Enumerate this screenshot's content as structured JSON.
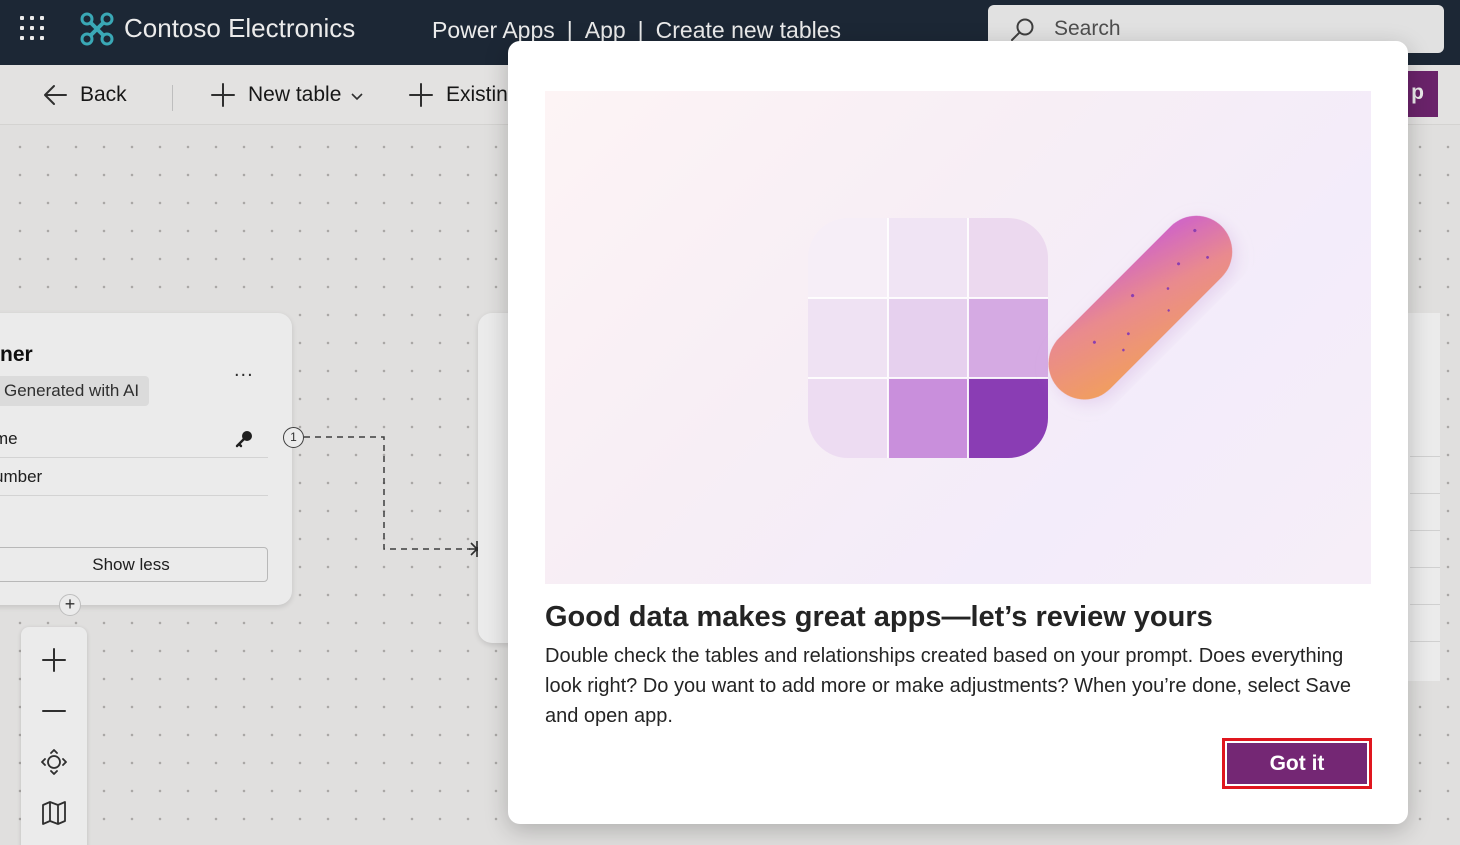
{
  "header": {
    "brand": "Contoso Electronics",
    "breadcrumbs": [
      "Power Apps",
      "App",
      "Create new tables"
    ],
    "breadcrumb_separator": "|",
    "search_placeholder": "Search"
  },
  "toolbar": {
    "back_label": "Back",
    "new_table_label": "New table",
    "existing_label": "Existin",
    "primary_partial": "p"
  },
  "table_card": {
    "title": "ner",
    "badge": "Generated with AI",
    "more": "...",
    "fields": [
      "me",
      "umber"
    ],
    "show_less": "Show less",
    "relationship_count": "1"
  },
  "dialog": {
    "title": "Good data makes great apps—let’s review yours",
    "body": "Double check the tables and relationships created based on your prompt. Does everything look right? Do you want to add more or make adjustments? When you’re done, select Save and open app.",
    "button": "Got it"
  },
  "colors": {
    "header_bg": "#1f2b3a",
    "accent": "#742774",
    "highlight_border": "#e0161e"
  }
}
